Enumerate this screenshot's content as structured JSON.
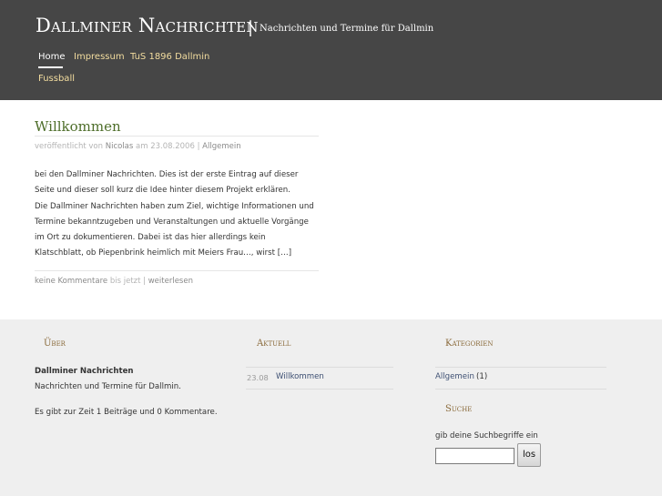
{
  "header": {
    "site_title": "Dallminer Nachrichten",
    "separator": "|",
    "tagline": "Nachrichten und Termine für Dallmin",
    "nav": [
      {
        "label": "Home",
        "active": true
      },
      {
        "label": "Impressum",
        "active": false
      },
      {
        "label": "TuS 1896 Dallmin",
        "active": false
      },
      {
        "label": "Fussball",
        "active": false
      }
    ]
  },
  "post": {
    "title": "Willkommen",
    "meta": {
      "prefix": "veröffentlicht von",
      "author": "Nicolas",
      "date_prefix": "am 23.08.2006",
      "separator": "|",
      "category": "Allgemein"
    },
    "body_lines": [
      "bei den Dallminer Nachrichten. Dies ist der erste Eintrag auf dieser",
      "Seite und dieser soll kurz die Idee hinter diesem Projekt erklären.",
      "Die Dallminer Nachrichten haben zum Ziel, wichtige Informationen und",
      "Termine bekanntzugeben und Veranstaltungen und aktuelle Vorgänge",
      "im Ort zu dokumentieren. Dabei ist das hier allerdings kein",
      "Klatschblatt, ob Piepenbrink heimlich mit Meiers Frau…, wirst […]"
    ],
    "footer": {
      "comments": "keine Kommentare",
      "until_now": "bis jetzt",
      "separator": "|",
      "read_more": "weiterlesen"
    }
  },
  "widgets": {
    "about": {
      "title": "Über",
      "name": "Dallminer Nachrichten",
      "description": "Nachrichten und Termine für Dallmin.",
      "stats": "Es gibt zur Zeit 1 Beiträge und 0 Kommentare."
    },
    "recent": {
      "title": "Aktuell",
      "items": [
        {
          "date": "23.08",
          "label": "Willkommen"
        }
      ]
    },
    "categories": {
      "title": "Kategorien",
      "items": [
        {
          "label": "Allgemein",
          "count": "(1)"
        }
      ]
    },
    "search": {
      "title": "Suche",
      "label": "gib deine Suchbegriffe ein",
      "value": "",
      "button_label": "los"
    }
  },
  "colors": {
    "header_bg": "#464646",
    "nav_link": "#f3dd9f",
    "post_title": "#4e6e2a",
    "widget_title": "#8a6a3a",
    "footer_bg": "#efefef",
    "link": "#3d4f72"
  }
}
